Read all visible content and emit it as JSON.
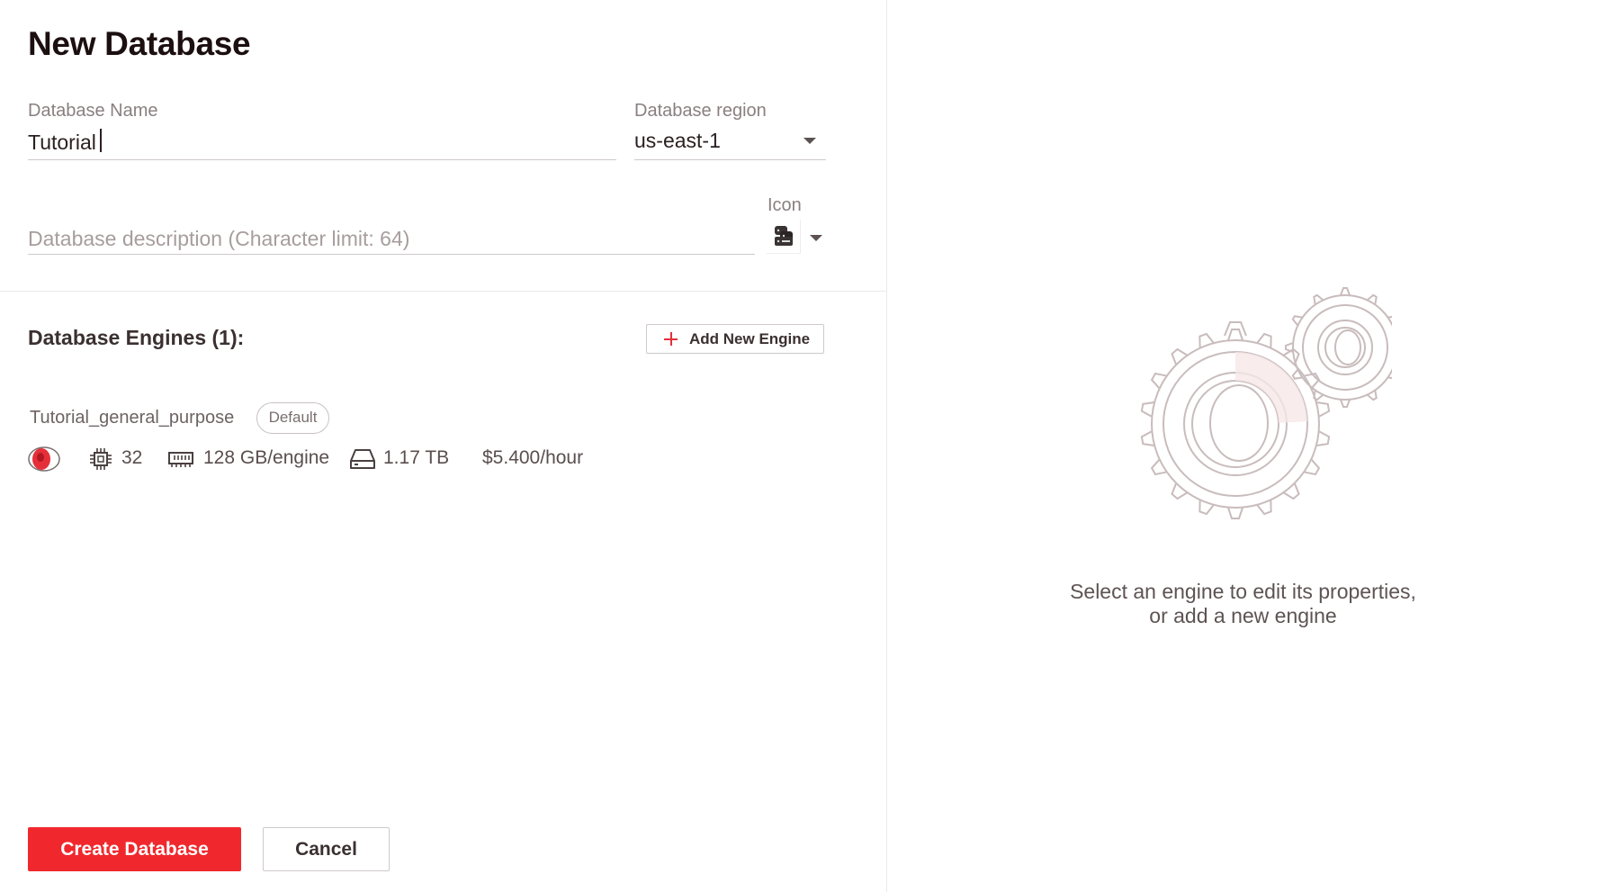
{
  "page": {
    "title": "New Database"
  },
  "form": {
    "name_label": "Database Name",
    "name_value": "Tutorial",
    "region_label": "Database region",
    "region_value": "us-east-1",
    "description_placeholder": "Database description (Character limit: 64)",
    "description_value": "",
    "icon_label": "Icon",
    "icon_selected": "database-server-icon"
  },
  "engines": {
    "title": "Database Engines (1):",
    "add_button_label": "Add New Engine",
    "items": [
      {
        "name": "Tutorial_general_purpose",
        "badge": "Default",
        "status_icon": "engine-status-icon",
        "cpu": "32",
        "ram": "128 GB/engine",
        "storage": "1.17 TB",
        "price": "$5.400/hour"
      }
    ]
  },
  "right_panel": {
    "illustration": "gears-illustration",
    "message_line1": "Select an engine to edit its properties,",
    "message_line2": "or add a new engine"
  },
  "actions": {
    "create_label": "Create Database",
    "cancel_label": "Cancel"
  },
  "colors": {
    "primary": "#f0282d",
    "accent_red": "#e5303a",
    "gear_stroke": "#c9bcbc",
    "gear_fill": "#f6e7e7"
  }
}
